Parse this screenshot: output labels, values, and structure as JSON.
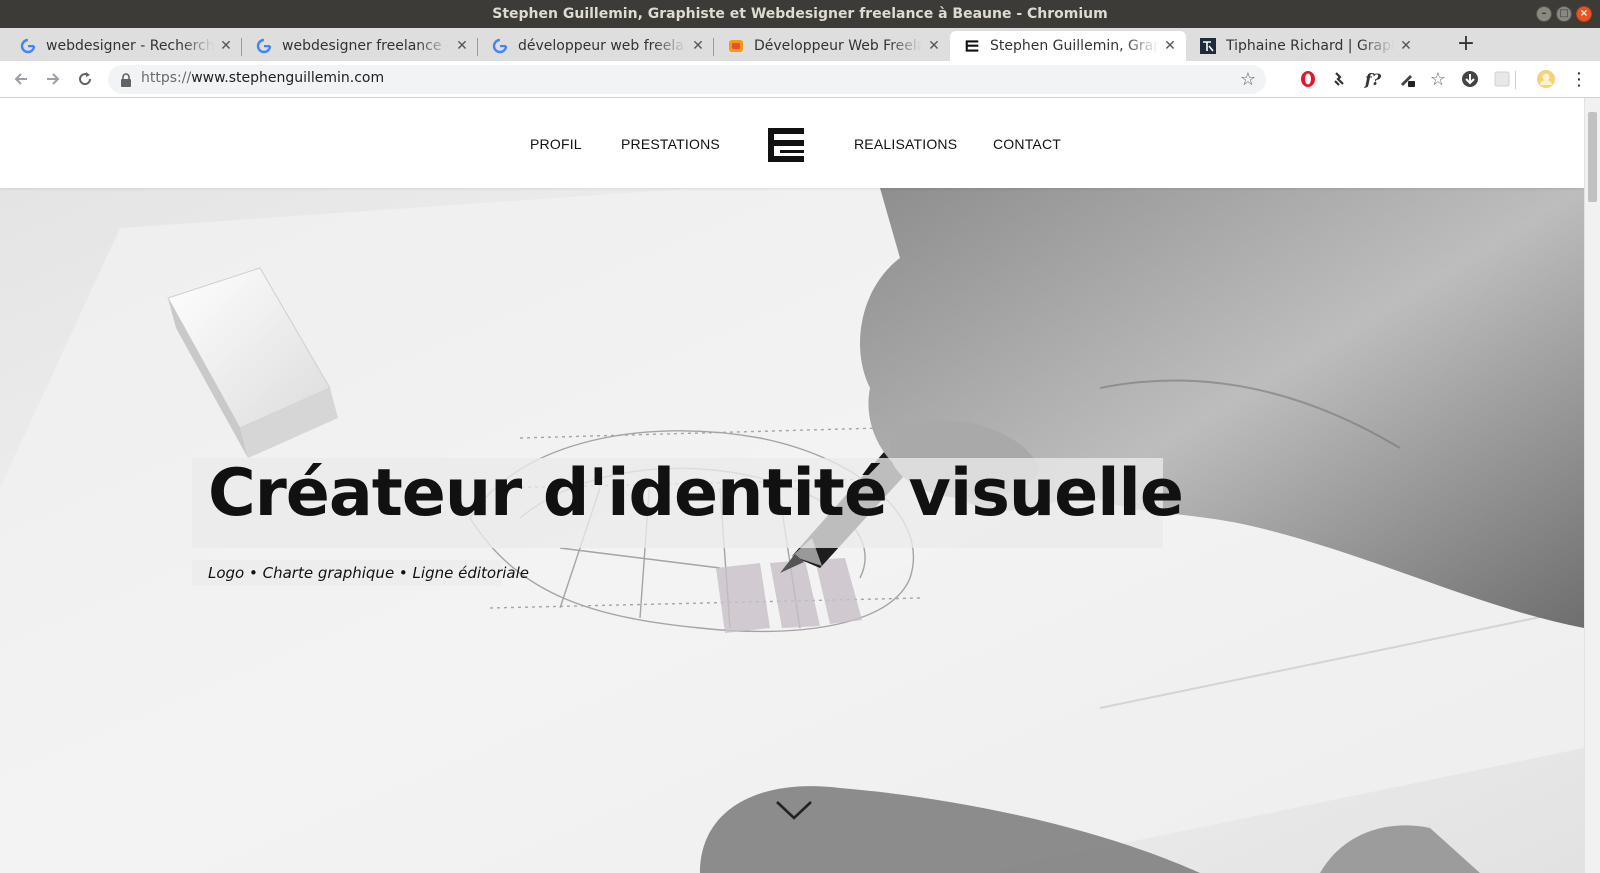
{
  "window": {
    "title": "Stephen Guillemin, Graphiste et Webdesigner freelance à Beaune - Chromium"
  },
  "tabs": [
    {
      "label": "webdesigner - Recherche Google",
      "favicon": "google-icon",
      "active": false
    },
    {
      "label": "webdesigner freelance - Recherche Google",
      "favicon": "google-icon",
      "active": false
    },
    {
      "label": "développeur web freelance - Recherche Google",
      "favicon": "google-icon",
      "active": false
    },
    {
      "label": "Développeur Web Freelance",
      "favicon": "orange-site-icon",
      "active": false
    },
    {
      "label": "Stephen Guillemin, Graphiste et Webdesigner",
      "favicon": "sg-logo-icon",
      "active": true
    },
    {
      "label": "Tiphaine Richard | Graphiste",
      "favicon": "tr-logo-icon",
      "active": false
    }
  ],
  "toolbar": {
    "url_scheme": "https://",
    "url_host": "www.stephenguillemin.com"
  },
  "extensions": [
    "opera-icon",
    "puzzle-arrow-icon",
    "font-query-icon",
    "pen-extension-icon",
    "star-extension-icon",
    "download-icon",
    "blank-extension-icon",
    "profile-avatar-icon",
    "menu-dots-icon"
  ],
  "site": {
    "nav": {
      "profil": "PROFIL",
      "prestations": "PRESTATIONS",
      "realisations": "REALISATIONS",
      "contact": "CONTACT"
    },
    "hero": {
      "title": "Créateur d'identité visuelle",
      "subtitle": "Logo • Charte graphique • Ligne éditoriale"
    }
  },
  "colors": {
    "titlebar_bg": "#3c3b37",
    "tabstrip_bg": "#dedede",
    "close_button": "#e95420",
    "text_dark": "#111111"
  }
}
